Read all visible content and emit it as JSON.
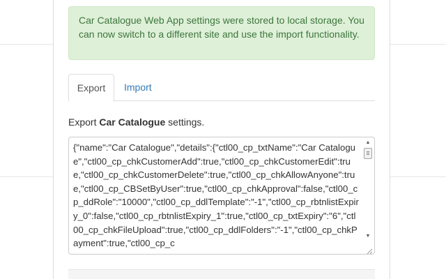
{
  "alert": {
    "message": "Car Catalogue Web App settings were stored to local storage. You can now switch to a different site and use the import functionality."
  },
  "tabs": [
    {
      "label": "Export",
      "active": true
    },
    {
      "label": "Import",
      "active": false
    }
  ],
  "export": {
    "prefix": "Export ",
    "app_name": "Car Catalogue",
    "suffix": " settings.",
    "settings_json": "{\"name\":\"Car Catalogue\",\"details\":{\"ctl00_cp_txtName\":\"Car Catalogue\",\"ctl00_cp_chkCustomerAdd\":true,\"ctl00_cp_chkCustomerEdit\":true,\"ctl00_cp_chkCustomerDelete\":true,\"ctl00_cp_chkAllowAnyone\":true,\"ctl00_cp_CBSetByUser\":true,\"ctl00_cp_chkApproval\":false,\"ctl00_cp_ddRole\":\"10000\",\"ctl00_cp_ddlTemplate\":\"-1\",\"ctl00_cp_rbtnlistExpiry_0\":false,\"ctl00_cp_rbtnlistExpiry_1\":true,\"ctl00_cp_txtExpiry\":\"6\",\"ctl00_cp_chkFileUpload\":true,\"ctl00_cp_ddlFolders\":\"-1\",\"ctl00_cp_chkPayment\":true,\"ctl00_cp_c"
  },
  "colors": {
    "alert_bg": "#dff0d8",
    "alert_text": "#3c763d",
    "link": "#337ab7"
  },
  "icons": {
    "scroll_up": "triangle-up-icon",
    "scroll_down": "triangle-down-icon",
    "resize": "resize-grip-icon"
  }
}
